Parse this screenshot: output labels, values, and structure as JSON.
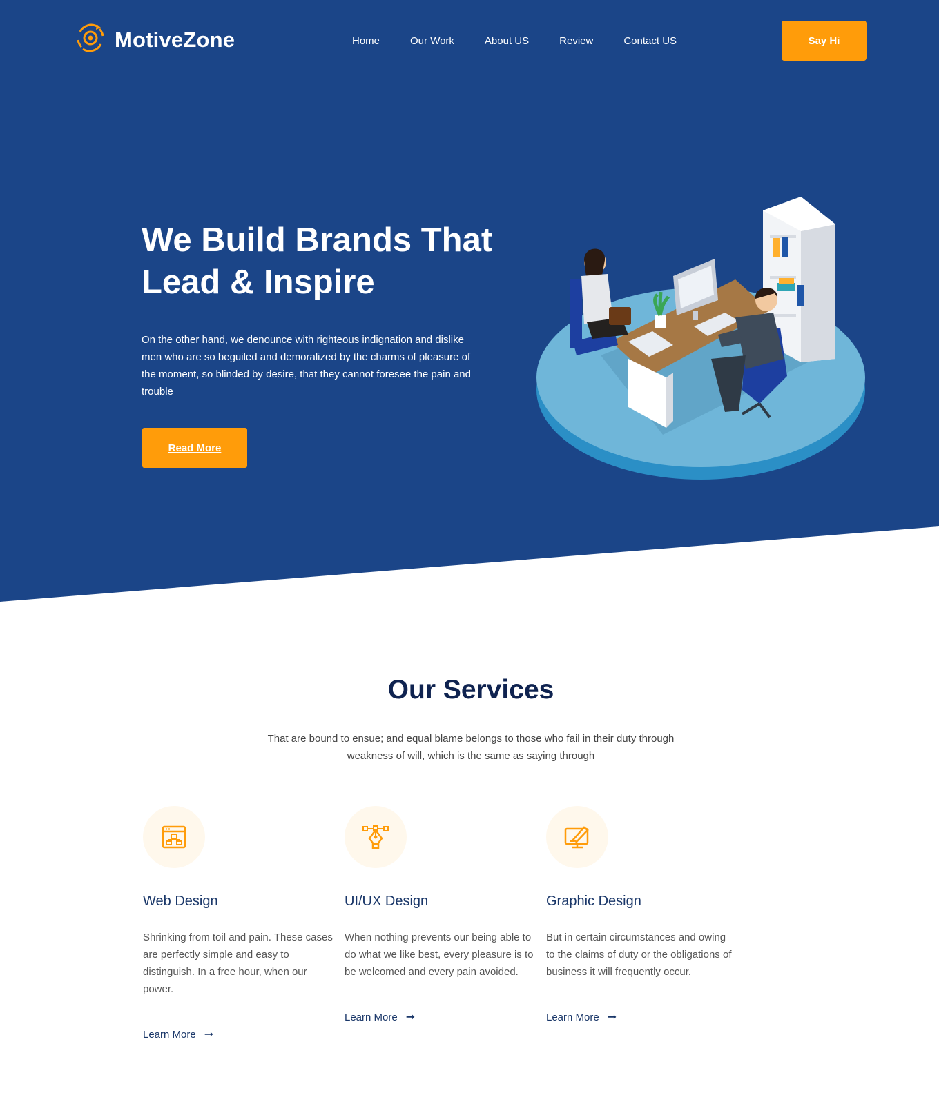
{
  "brand": {
    "name": "MotiveZone",
    "accent": "#ff9c0a",
    "primary": "#1b4588"
  },
  "nav": {
    "items": [
      {
        "label": "Home"
      },
      {
        "label": "Our Work"
      },
      {
        "label": "About US"
      },
      {
        "label": "Review"
      },
      {
        "label": "Contact US"
      }
    ],
    "cta": "Say Hi"
  },
  "hero": {
    "title_line1": "We Build Brands That",
    "title_line2": "Lead & Inspire",
    "text": "On the other hand, we denounce with righteous indignation and dislike men who are so beguiled and demoralized by the charms of pleasure of the moment, so blinded by desire, that they cannot foresee the pain and trouble",
    "button": "Read More"
  },
  "services": {
    "title": "Our Services",
    "subtitle": "That are bound to ensue; and equal blame belongs to those who fail in their duty through weakness of will, which is the same as saying through",
    "cards": [
      {
        "icon": "web-design-icon",
        "title": "Web Design",
        "text": "Shrinking from toil and pain. These cases are perfectly simple and easy to distinguish. In a free hour, when our power.",
        "link": "Learn More"
      },
      {
        "icon": "pen-tool-icon",
        "title": "UI/UX Design",
        "text": "When nothing prevents our being able to do what we like best, every pleasure is to be welcomed and every pain avoided.",
        "link": "Learn More"
      },
      {
        "icon": "graphic-design-icon",
        "title": "Graphic Design",
        "text": "But in certain circumstances and owing to the claims of duty or the obligations of business it will frequently occur.",
        "link": "Learn More"
      }
    ]
  }
}
